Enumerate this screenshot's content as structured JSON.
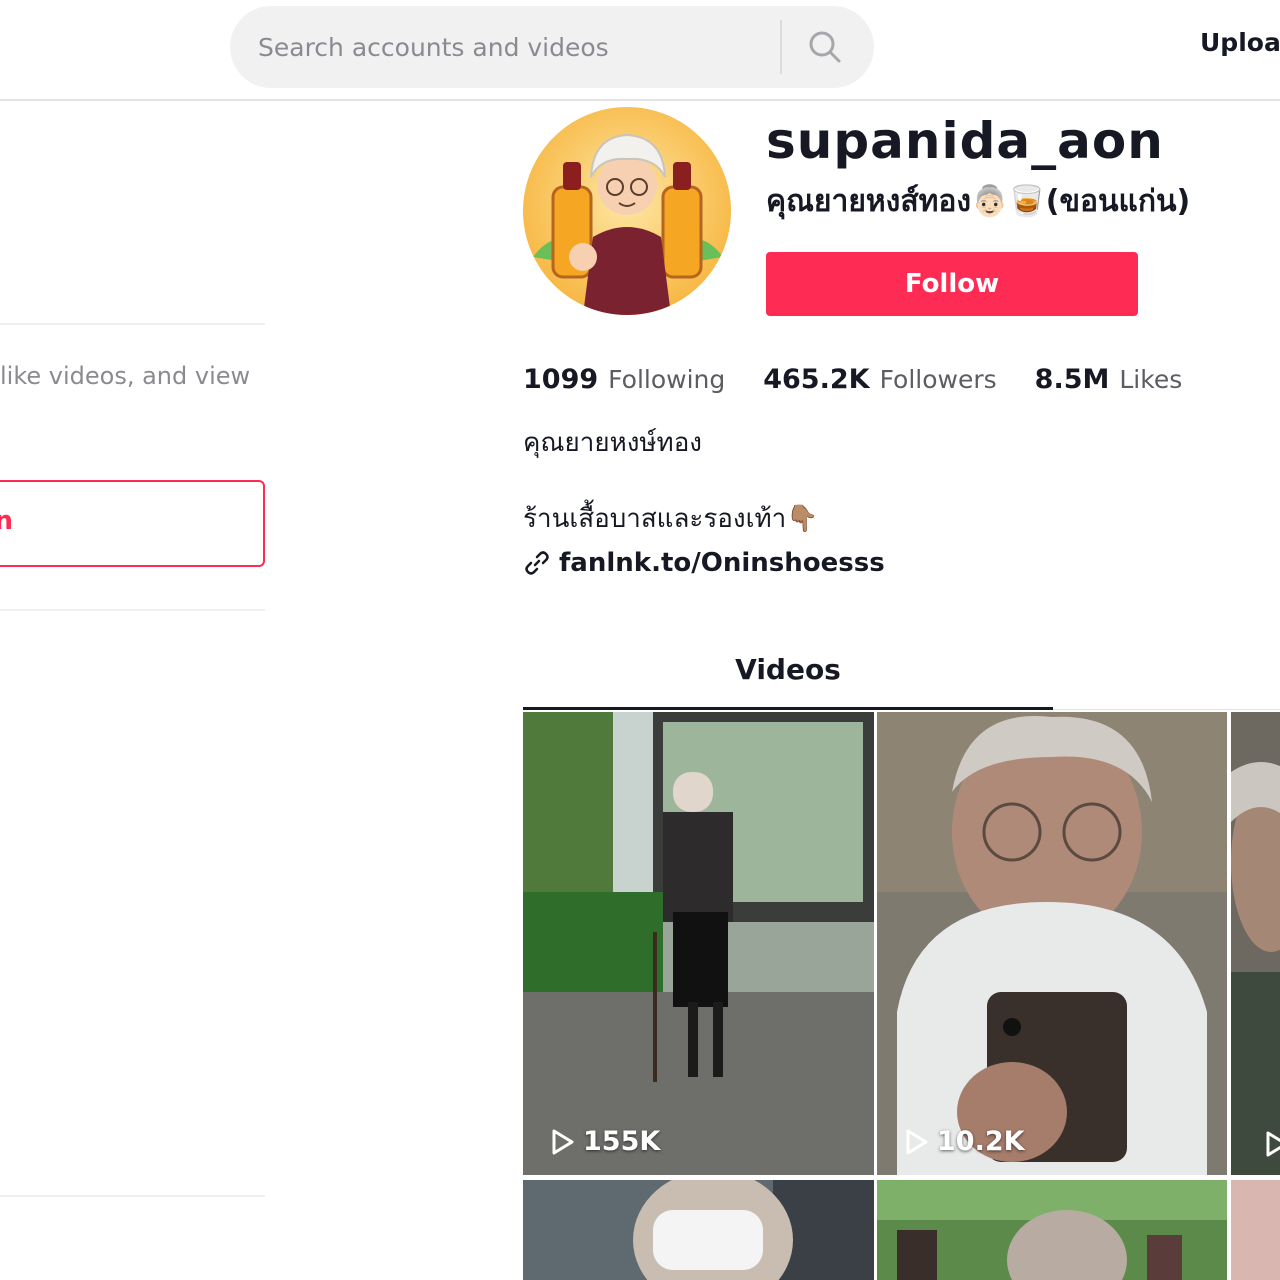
{
  "header": {
    "search_placeholder": "Search accounts and videos",
    "upload_label": "Upload"
  },
  "sidebar": {
    "login_prompt": "like videos, and view",
    "login_button_label": "n"
  },
  "profile": {
    "username": "supanida_aon",
    "nickname": "คุณยายหงส์ทอง👵🏻🥃(ขอนแก่น)",
    "follow_label": "Follow",
    "stats": [
      {
        "value": "1099",
        "label": "Following"
      },
      {
        "value": "465.2K",
        "label": "Followers"
      },
      {
        "value": "8.5M",
        "label": "Likes"
      }
    ],
    "bio_line1": "คุณยายหงษ์ทอง",
    "bio_line2": "ร้านเสื้อบาสและรองเท้า👇🏽",
    "link": "fanlnk.to/Oninshoesss"
  },
  "tabs": {
    "videos_label": "Videos"
  },
  "videos": [
    {
      "views": "155K"
    },
    {
      "views": "10.2K"
    },
    {
      "views": ""
    }
  ],
  "colors": {
    "accent": "#fe2c55",
    "text": "#161823",
    "muted": "#8a8b91"
  }
}
